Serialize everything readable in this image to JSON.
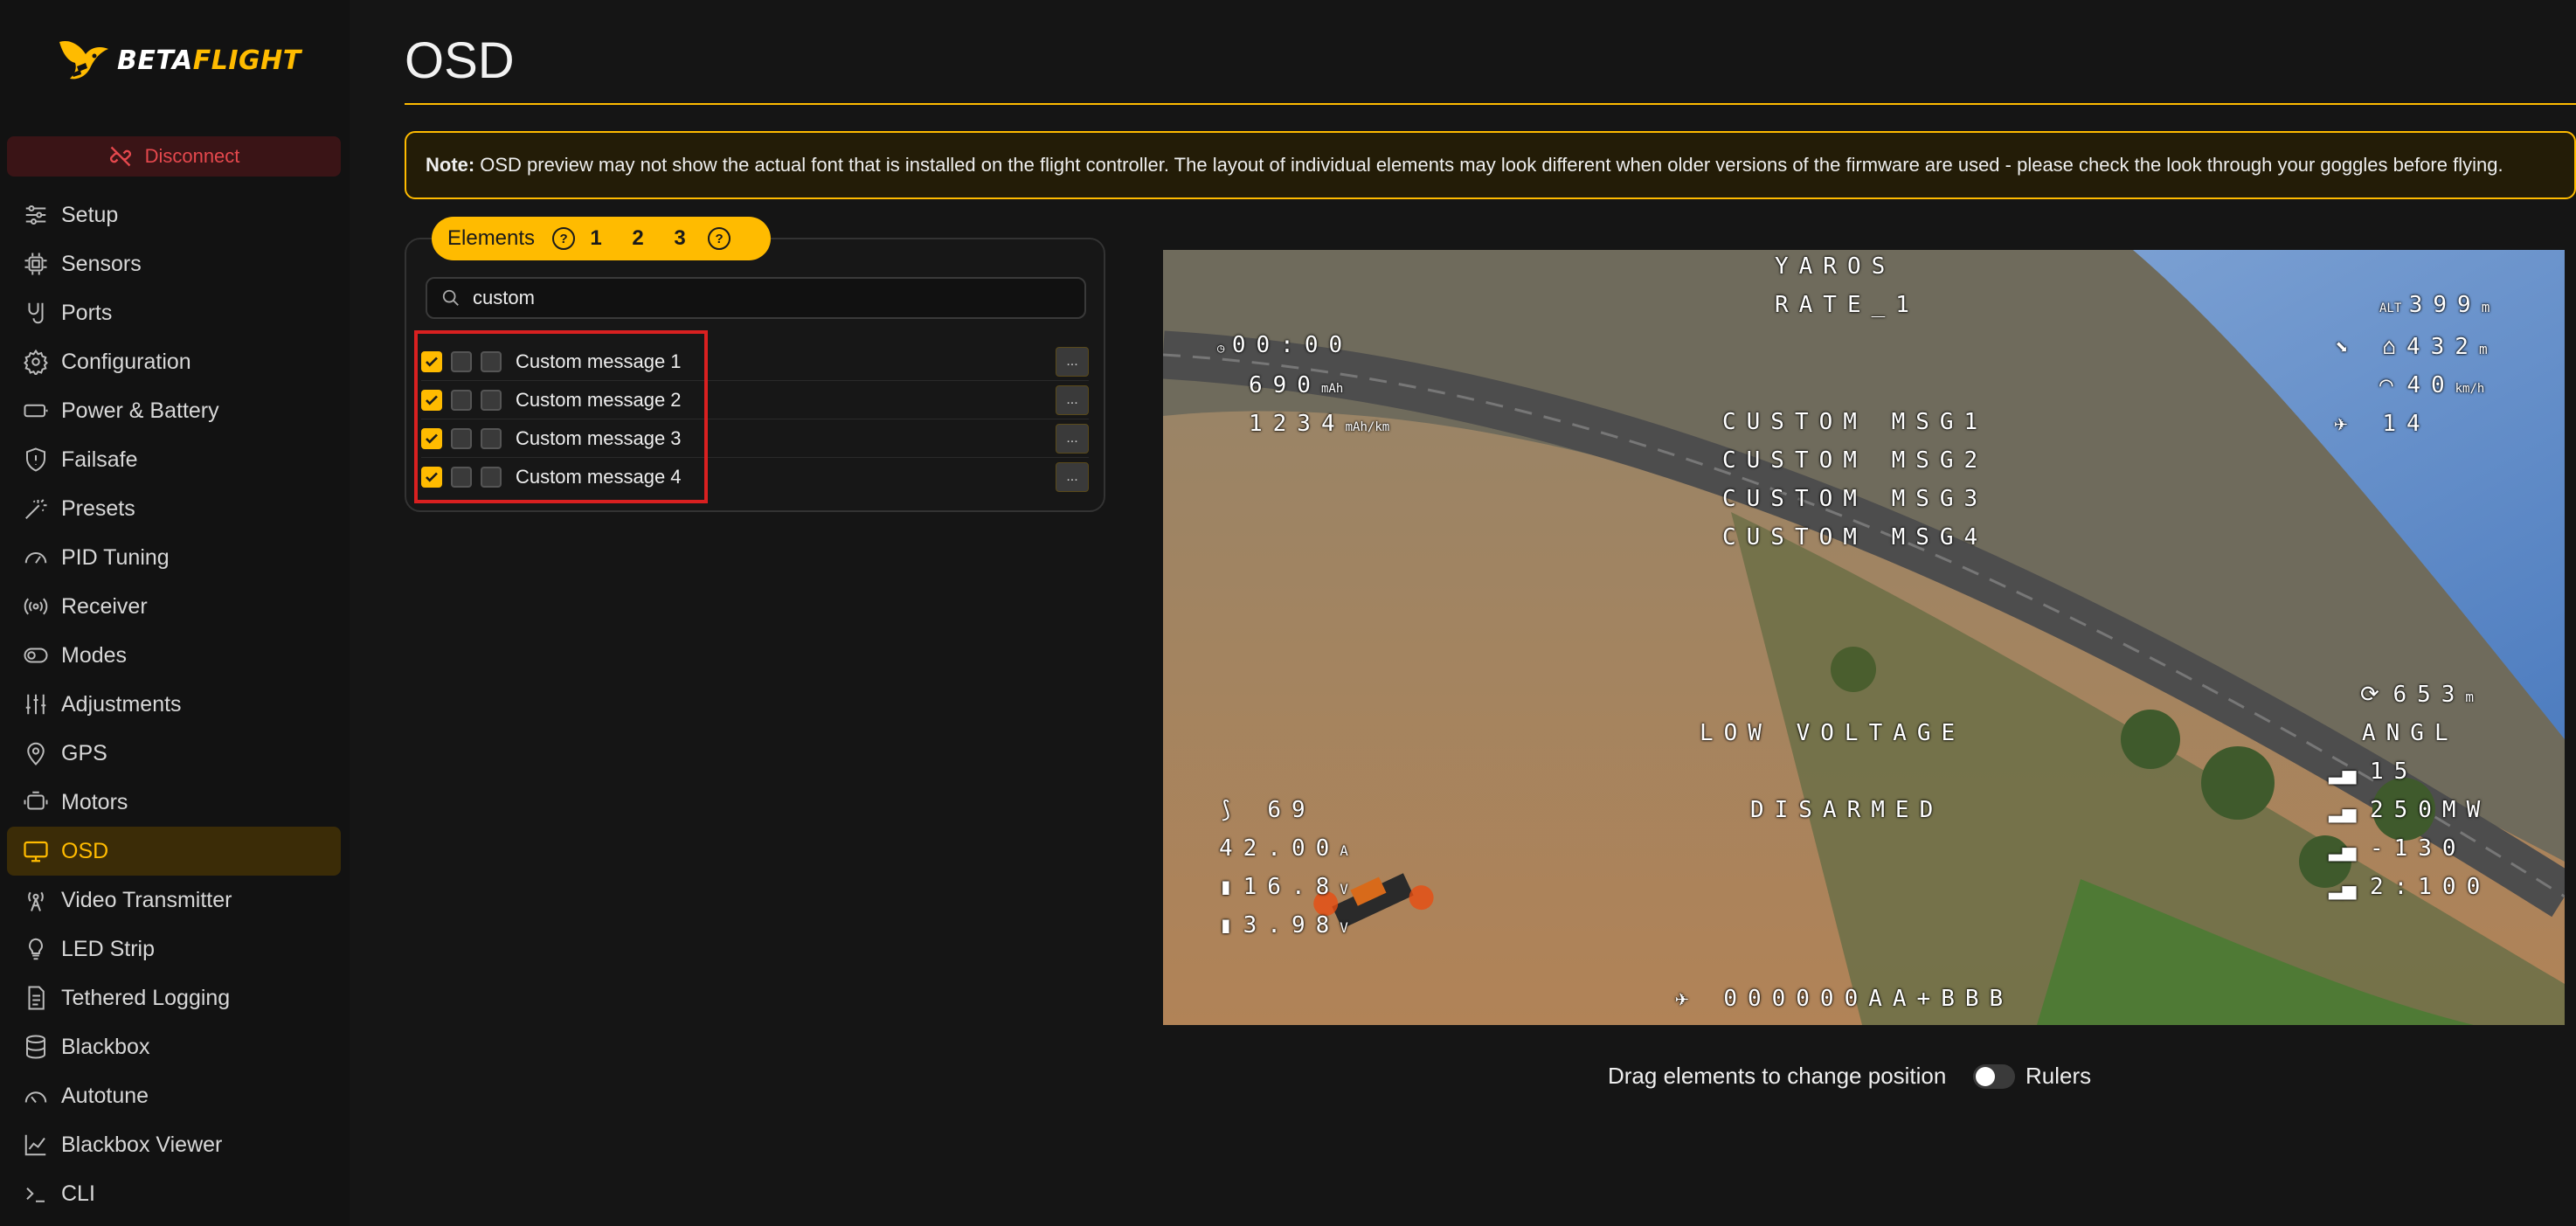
{
  "app": {
    "logo_a": "BETA",
    "logo_b": "FLIGHT"
  },
  "sidebar": {
    "disconnect_label": "Disconnect",
    "items": [
      {
        "label": "Setup",
        "icon": "sliders-icon"
      },
      {
        "label": "Sensors",
        "icon": "chip-icon"
      },
      {
        "label": "Ports",
        "icon": "ports-icon"
      },
      {
        "label": "Configuration",
        "icon": "gear-icon"
      },
      {
        "label": "Power & Battery",
        "icon": "battery-icon"
      },
      {
        "label": "Failsafe",
        "icon": "shield-icon"
      },
      {
        "label": "Presets",
        "icon": "wand-icon"
      },
      {
        "label": "PID Tuning",
        "icon": "gauge-icon"
      },
      {
        "label": "Receiver",
        "icon": "radio-icon"
      },
      {
        "label": "Modes",
        "icon": "toggle-icon"
      },
      {
        "label": "Adjustments",
        "icon": "adjust-icon"
      },
      {
        "label": "GPS",
        "icon": "pin-icon"
      },
      {
        "label": "Motors",
        "icon": "motor-icon"
      },
      {
        "label": "OSD",
        "icon": "monitor-icon"
      },
      {
        "label": "Video Transmitter",
        "icon": "antenna-icon"
      },
      {
        "label": "LED Strip",
        "icon": "bulb-icon"
      },
      {
        "label": "Tethered Logging",
        "icon": "document-icon"
      },
      {
        "label": "Blackbox",
        "icon": "database-icon"
      },
      {
        "label": "Autotune",
        "icon": "dial-icon"
      },
      {
        "label": "Blackbox Viewer",
        "icon": "chart-icon"
      },
      {
        "label": "CLI",
        "icon": "terminal-icon"
      }
    ],
    "active": "OSD"
  },
  "main": {
    "title": "OSD",
    "note_bold": "Note:",
    "note_text": "OSD preview may not show the actual font that is installed on the flight controller. The layout of individual elements may look different when older versions of the firmware are used - please check the look through your goggles before flying."
  },
  "elements": {
    "tab_label": "Elements",
    "profile_tabs": [
      "1",
      "2",
      "3"
    ],
    "search_value": "custom",
    "rows": [
      {
        "label": "Custom message 1",
        "more": "..."
      },
      {
        "label": "Custom message 2",
        "more": "..."
      },
      {
        "label": "Custom message 3",
        "more": "..."
      },
      {
        "label": "Custom message 4",
        "more": "..."
      }
    ]
  },
  "osd": {
    "craft": "YAROS",
    "rate": "RATE_1",
    "timer": "00:00",
    "mah": "690",
    "efficiency": "1234",
    "msg1": "CUSTOM MSG1",
    "msg2": "CUSTOM MSG2",
    "msg3": "CUSTOM MSG3",
    "msg4": "CUSTOM MSG4",
    "altitude": "399",
    "home_distance": "432",
    "speed": "40",
    "sats": "14",
    "flight_dist": "653",
    "mode": "ANGL",
    "low_voltage": "LOW VOLTAGE",
    "disarmed": "DISARMED",
    "throttle": "69",
    "current": "42.00",
    "battery_v": "16.8",
    "cell_v": "3.98",
    "rssi": "15",
    "vtx_power": "250MW",
    "rssi_dbm": "-130",
    "link": "2:100",
    "gps_coords": "000000AA+BBB"
  },
  "footer": {
    "drag_hint": "Drag elements to change position",
    "rulers_label": "Rulers"
  },
  "colors": {
    "accent": "#ffbb00",
    "danger": "#d92020",
    "bg": "#151515"
  }
}
